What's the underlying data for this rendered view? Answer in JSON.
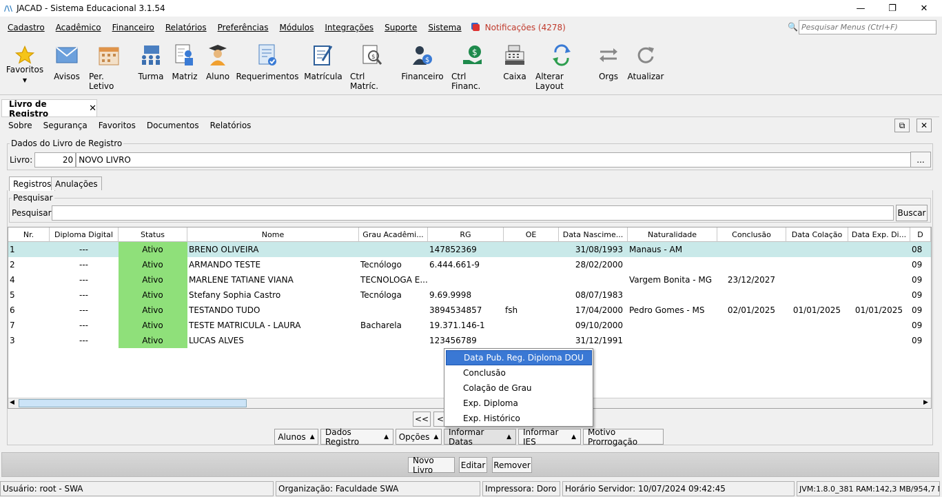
{
  "window": {
    "title": "JACAD - Sistema Educacional 3.1.54"
  },
  "menu": {
    "items": [
      "Cadastro",
      "Acadêmico",
      "Financeiro",
      "Relatórios",
      "Preferências",
      "Módulos",
      "Integrações",
      "Suporte",
      "Sistema"
    ],
    "notifications": "Notificações (4278)",
    "search_placeholder": "Pesquisar Menus (Ctrl+F)"
  },
  "toolbar": {
    "items": [
      {
        "label": "Favoritos",
        "icon": "star-icon"
      },
      {
        "label": "Avisos",
        "icon": "envelope-icon"
      },
      {
        "label": "Per. Letivo",
        "icon": "calendar-icon"
      },
      {
        "label": "Turma",
        "icon": "class-icon"
      },
      {
        "label": "Matriz",
        "icon": "matrix-icon"
      },
      {
        "label": "Aluno",
        "icon": "student-icon"
      },
      {
        "label": "Requerimentos",
        "icon": "request-icon"
      },
      {
        "label": "Matrícula",
        "icon": "enrollment-icon"
      },
      {
        "label": "Ctrl Matríc.",
        "icon": "enrollment-control-icon"
      },
      {
        "label": "Financeiro",
        "icon": "finance-icon"
      },
      {
        "label": "Ctrl Financ.",
        "icon": "finance-control-icon"
      },
      {
        "label": "Caixa",
        "icon": "cash-register-icon"
      },
      {
        "label": "Alterar Layout",
        "icon": "layout-icon"
      },
      {
        "label": "Orgs",
        "icon": "orgs-icon"
      },
      {
        "label": "Atualizar",
        "icon": "refresh-icon"
      }
    ]
  },
  "doc_tab": {
    "label": "Livro de Registro",
    "close": "✕"
  },
  "submenu": [
    "Sobre",
    "Segurança",
    "Favoritos",
    "Documentos",
    "Relatórios"
  ],
  "livro": {
    "legend": "Dados do Livro de Registro",
    "label": "Livro:",
    "number": "20",
    "name": "NOVO LIVRO",
    "browse": "..."
  },
  "tabs": [
    "Registros",
    "Anulações"
  ],
  "pesquisa": {
    "legend": "Pesquisar",
    "label": "Pesquisar:",
    "value": "",
    "button": "Buscar"
  },
  "table": {
    "columns": [
      "Nr.",
      "Diploma Digital",
      "Status",
      "Nome",
      "Grau Acadêmi...",
      "RG",
      "OE",
      "Data Nascime...",
      "Naturalidade",
      "Conclusão",
      "Data Colação",
      "Data Exp. Di...",
      "D"
    ],
    "rows": [
      [
        "1",
        "---",
        "Ativo",
        "BRENO OLIVEIRA",
        "",
        "147852369",
        "",
        "31/08/1993",
        "Manaus - AM",
        "",
        "",
        "",
        "08"
      ],
      [
        "2",
        "---",
        "Ativo",
        "ARMANDO TESTE",
        "Tecnólogo",
        "6.444.661-9",
        "",
        "28/02/2000",
        "",
        "",
        "",
        "",
        "09"
      ],
      [
        "4",
        "---",
        "Ativo",
        "MARLENE TATIANE VIANA",
        "TECNOLOGA E...",
        "",
        "",
        "",
        "Vargem Bonita - MG",
        "23/12/2027",
        "",
        "",
        "09"
      ],
      [
        "5",
        "---",
        "Ativo",
        "Stefany Sophia Castro",
        "Tecnóloga",
        "9.69.9998",
        "",
        "08/07/1983",
        "",
        "",
        "",
        "",
        "09"
      ],
      [
        "6",
        "---",
        "Ativo",
        "TESTANDO TUDO",
        "",
        "3894534857",
        "fsh",
        "17/04/2000",
        "Pedro Gomes - MS",
        "02/01/2025",
        "01/01/2025",
        "01/01/2025",
        "09"
      ],
      [
        "7",
        "---",
        "Ativo",
        "TESTE MATRICULA - LAURA",
        "Bacharela",
        "19.371.146-1",
        "",
        "09/10/2000",
        "",
        "",
        "",
        "",
        "09"
      ],
      [
        "3",
        "---",
        "Ativo",
        "LUCAS ALVES",
        "",
        "123456789",
        "",
        "31/12/1991",
        "",
        "",
        "",
        "",
        "09"
      ]
    ]
  },
  "pager": {
    "first": "<<",
    "prev": "<"
  },
  "actions": [
    "Alunos",
    "Dados Registro",
    "Opções",
    "Informar Datas",
    "Informar IES",
    "Motivo Prorrogação"
  ],
  "popup": [
    "Data Pub. Reg. Diploma DOU",
    "Conclusão",
    "Colação de Grau",
    "Exp. Diploma",
    "Exp. Histórico"
  ],
  "bottom": [
    "Novo Livro",
    "Editar",
    "Remover"
  ],
  "status": {
    "user": "Usuário: root - SWA",
    "org": "Organização: Faculdade SWA",
    "printer": "Impressora: Doro ...",
    "server_time": "Horário Servidor: 10/07/2024 09:42:45",
    "jvm": "JVM:1.8.0_381  RAM:142,3 MB/954,7 MB"
  },
  "colors": {
    "status_green": "#8fe07a",
    "selected_row": "#c9e9e9",
    "popup_highlight": "#3a78d4",
    "notif_red": "#c0392b"
  }
}
